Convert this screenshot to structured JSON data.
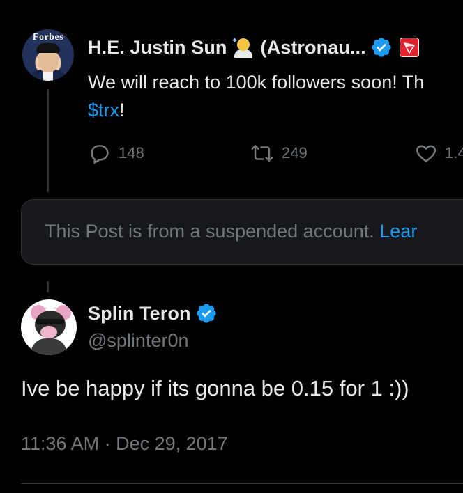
{
  "colors": {
    "background": "#000000",
    "text_primary": "#e7e9ea",
    "text_secondary": "#71767b",
    "link": "#1d9bf0",
    "verified": "#1d9bf0",
    "affiliate_badge": "#e0232e",
    "notice_bg": "#16181c",
    "border": "#2f3336"
  },
  "quoted_post": {
    "avatar_badge_text": "Forbes",
    "display_name": "H.E. Justin Sun",
    "name_suffix": "(Astronau...",
    "emoji_icon": "astronaut-emoji-icon",
    "verified_icon": "verified-badge-icon",
    "affiliate_icon": "tron-affiliate-icon",
    "text_line1": "We will reach to 100k followers soon! Th",
    "text_line2_link": "$trx",
    "text_line2_rest": "!",
    "actions": {
      "replies": "148",
      "retweets": "249",
      "likes": "1.4"
    }
  },
  "suspended_notice": {
    "text": "This Post is from a suspended account.",
    "link": "Lear"
  },
  "reply_post": {
    "display_name": "Splin Teron",
    "handle": "@splinter0n",
    "text": "Ive be happy if its gonna be 0.15 for 1 :))",
    "timestamp": "11:36 AM · Dec 29, 2017"
  }
}
